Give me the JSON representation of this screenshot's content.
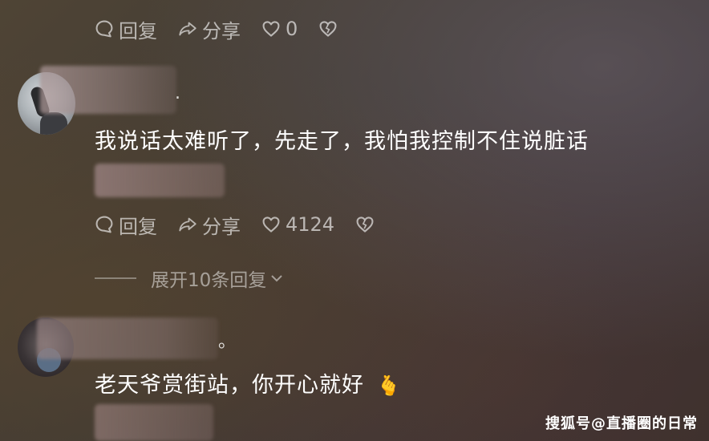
{
  "comment_top": {
    "reply_label": "回复",
    "share_label": "分享",
    "like_count": "0"
  },
  "comment_1": {
    "dot": ".",
    "text": "我说话太难听了，先走了，我怕我控制不住说脏话",
    "reply_label": "回复",
    "share_label": "分享",
    "like_count": "4124",
    "expand_label": "展开10条回复"
  },
  "comment_2": {
    "dot": "。",
    "text": "老天爷赏街站，你开心就好",
    "emoji": "🫰"
  },
  "watermark": "搜狐号@直播圈的日常",
  "icons": [
    "comment-bubble-icon",
    "share-arrow-icon",
    "heart-icon",
    "broken-heart-icon",
    "chevron-down-icon"
  ]
}
